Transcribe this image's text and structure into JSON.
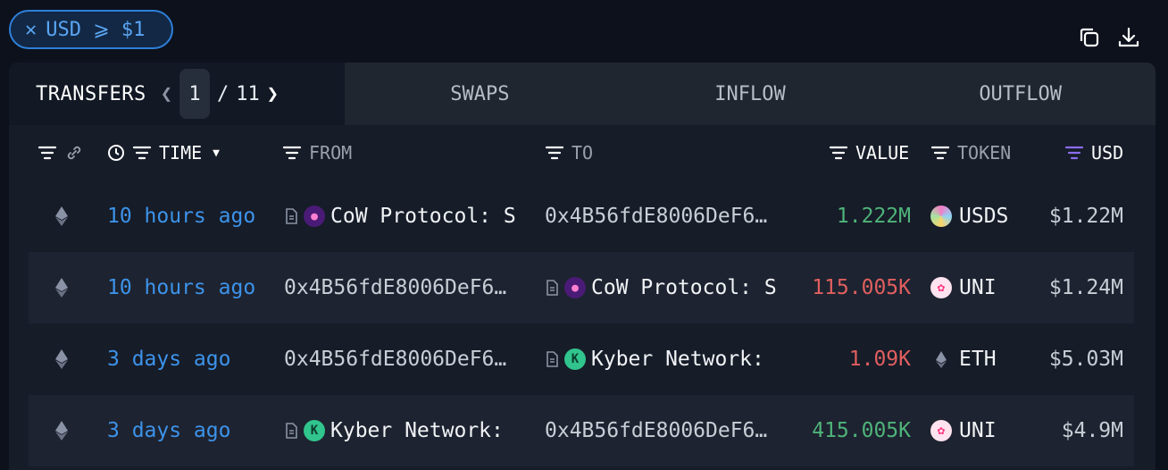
{
  "filter": {
    "chip_label": "USD ⩾ $1"
  },
  "actions": {
    "copy_icon": "copy-icon",
    "download_icon": "download-icon"
  },
  "tabs": {
    "transfers": {
      "label": "TRANSFERS",
      "page": "1",
      "separator": "/",
      "total": "11"
    },
    "others": [
      "SWAPS",
      "INFLOW",
      "OUTFLOW"
    ]
  },
  "columns": {
    "time": "TIME",
    "from": "FROM",
    "to": "TO",
    "value": "VALUE",
    "token": "TOKEN",
    "usd": "USD"
  },
  "rows": [
    {
      "time": "10 hours ago",
      "from": "CoW Protocol: S",
      "to": "0x4B56fdE8006DeF6…",
      "value": "1.222M",
      "token": "USDS",
      "usd": "$1.22M"
    },
    {
      "time": "10 hours ago",
      "from": "0x4B56fdE8006DeF6…",
      "to": "CoW Protocol: S",
      "value": "115.005K",
      "token": "UNI",
      "usd": "$1.24M"
    },
    {
      "time": "3 days ago",
      "from": "0x4B56fdE8006DeF6…",
      "to": "Kyber Network:",
      "value": "1.09K",
      "token": "ETH",
      "usd": "$5.03M"
    },
    {
      "time": "3 days ago",
      "from": "Kyber Network:",
      "to": "0x4B56fdE8006DeF6…",
      "value": "415.005K",
      "token": "UNI",
      "usd": "$4.9M"
    }
  ],
  "colors": {
    "accent": "#2f7fd8",
    "positive": "#4fb37a",
    "negative": "#e05f5f",
    "usd_filter_active": "#8b6cf0"
  }
}
